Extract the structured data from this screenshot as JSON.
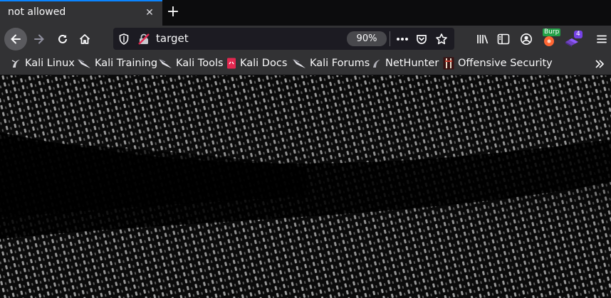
{
  "tab": {
    "title": "not allowed"
  },
  "urlbar": {
    "url": "target",
    "zoom": "90%"
  },
  "extensions": {
    "burp_label": "Burp",
    "badge_count": "4"
  },
  "bookmarks": [
    {
      "label": "Kali Linux",
      "icon": "kali-dragon-icon"
    },
    {
      "label": "Kali Training",
      "icon": "kali-dragon-icon"
    },
    {
      "label": "Kali Tools",
      "icon": "kali-dragon-icon"
    },
    {
      "label": "Kali Docs",
      "icon": "kali-docs-icon"
    },
    {
      "label": "Kali Forums",
      "icon": "kali-dragon-icon"
    },
    {
      "label": "NetHunter",
      "icon": "nethunter-icon"
    },
    {
      "label": "Offensive Security",
      "icon": "offsec-icon"
    }
  ],
  "colors": {
    "accent": "#0a84ff",
    "toolbar": "#323234",
    "tabstrip": "#0c0c0d",
    "burp": "#ff6633",
    "badge": "#7542e5"
  }
}
